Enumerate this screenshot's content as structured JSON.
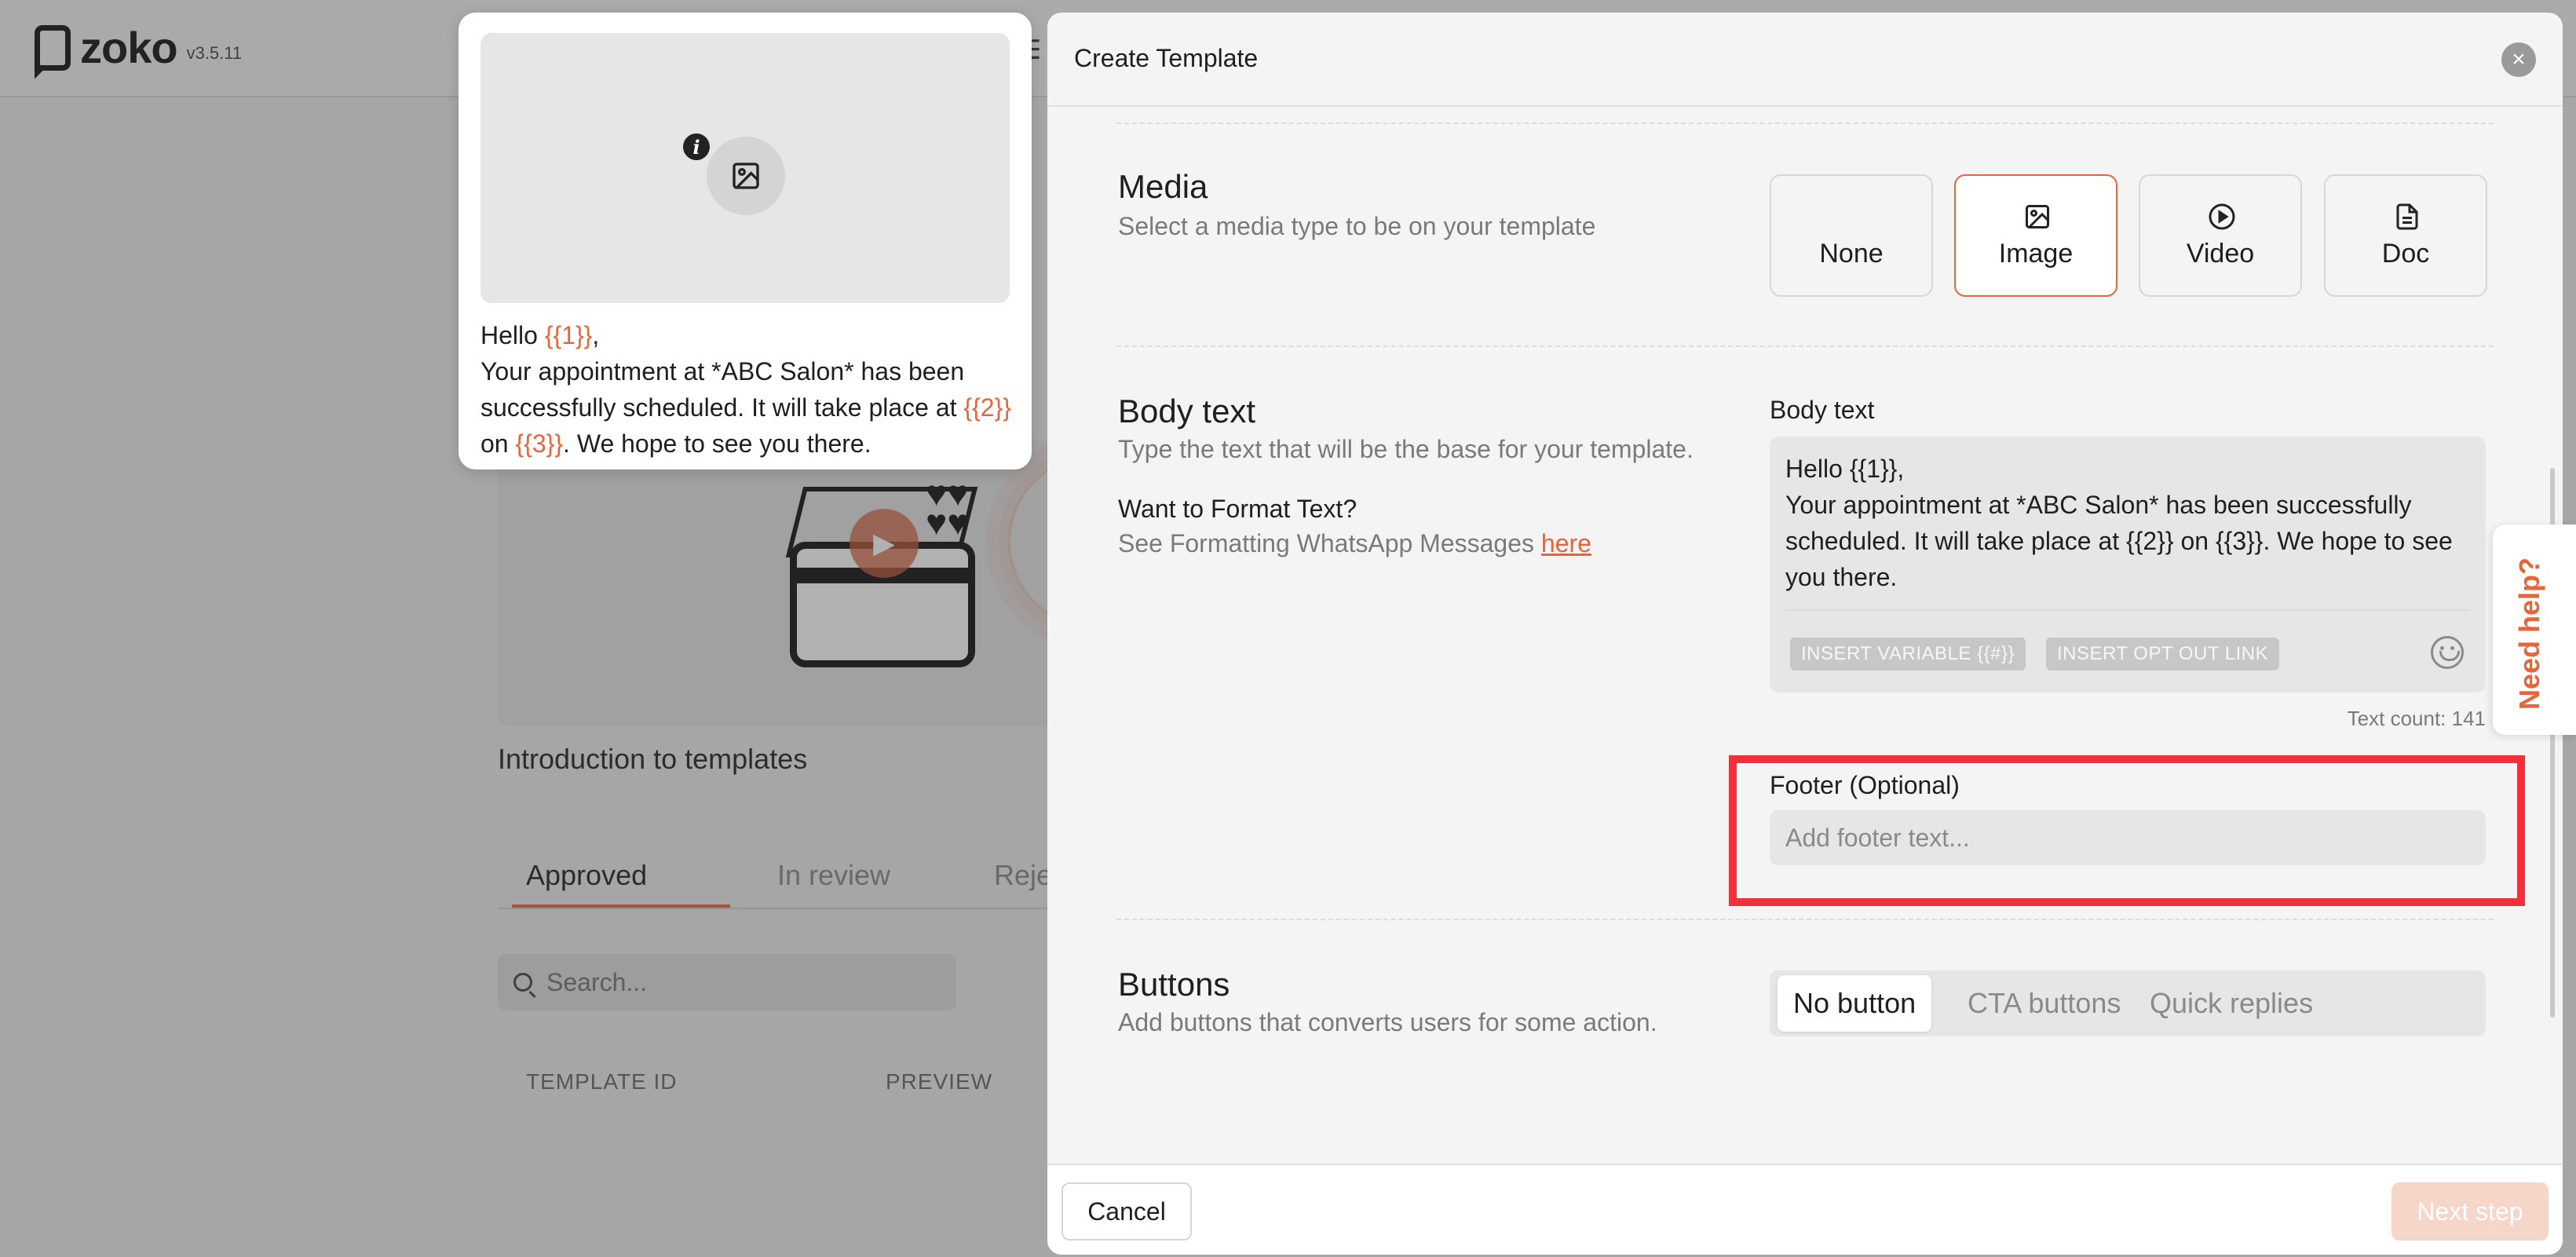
{
  "app": {
    "name": "zoko",
    "version": "v3.5.11"
  },
  "background": {
    "video_title": "Introduction to templates",
    "tabs": [
      "Approved",
      "In review",
      "Reje"
    ],
    "search_placeholder": "Search...",
    "columns": [
      "TEMPLATE ID",
      "PREVIEW"
    ]
  },
  "preview": {
    "greeting_prefix": "Hello ",
    "var1": "{{1}}",
    "greeting_suffix": ",",
    "line_a": "Your appointment at *ABC Salon* has been successfully scheduled. It will take place at ",
    "var2": "{{2}}",
    "line_b": " on ",
    "var3": "{{3}}",
    "line_c": ". We hope to see you there."
  },
  "modal": {
    "title": "Create Template",
    "media": {
      "title": "Media",
      "desc": "Select a media type to be on your template",
      "options": [
        "None",
        "Image",
        "Video",
        "Doc"
      ],
      "selected": "Image"
    },
    "body": {
      "title": "Body text",
      "desc": "Type the text that will be the base for your template.",
      "format_label": "Want to Format Text?",
      "format_desc": "See Formatting WhatsApp Messages ",
      "format_link": "here",
      "field_label": "Body text",
      "value_line1": "Hello {{1}},",
      "value_line2": "Your appointment at *ABC Salon* has been successfully scheduled. It will take place at {{2}} on {{3}}. We hope to see you there.",
      "chip_variable": "INSERT VARIABLE {{#}}",
      "chip_optout": "INSERT OPT OUT LINK",
      "text_count": "Text count: 141"
    },
    "footer": {
      "label": "Footer (Optional)",
      "placeholder": "Add footer text..."
    },
    "buttons": {
      "title": "Buttons",
      "desc": "Add buttons that converts users for some action.",
      "options": [
        "No button",
        "CTA buttons",
        "Quick replies"
      ],
      "selected": "No button"
    },
    "cancel_label": "Cancel",
    "next_label": "Next step"
  },
  "help": {
    "label": "Need help?"
  },
  "colors": {
    "accent": "#e8643a",
    "highlight": "#f0303a"
  }
}
